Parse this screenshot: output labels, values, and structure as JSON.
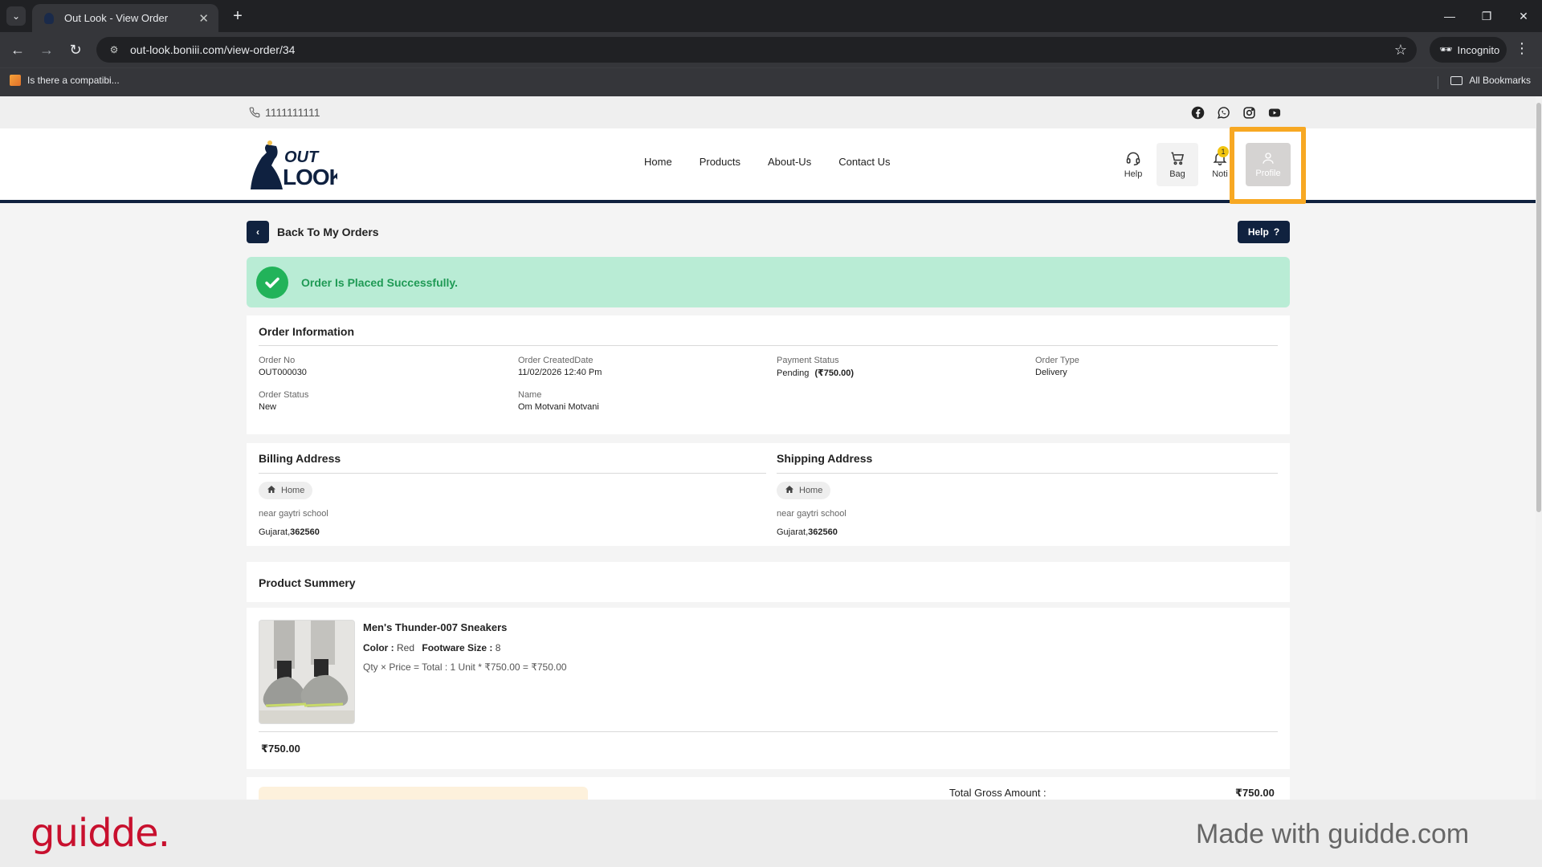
{
  "browser": {
    "tab_title": "Out Look - View Order",
    "url": "out-look.boniii.com/view-order/34",
    "profile_label": "Incognito",
    "bookmark_item": "Is there a compatibi...",
    "all_bookmarks": "All Bookmarks"
  },
  "site": {
    "phone": "1111111111",
    "socials": [
      "facebook-icon",
      "whatsapp-icon",
      "instagram-icon",
      "youtube-icon"
    ],
    "logo_text_top": "OUT",
    "logo_text_bottom": "LOOK",
    "nav": [
      "Home",
      "Products",
      "About-Us",
      "Contact Us"
    ],
    "header_actions": {
      "help": "Help",
      "bag": "Bag",
      "notifications": "Noti",
      "notification_count": "1",
      "profile": "Profile"
    }
  },
  "page": {
    "back_label": "Back To My Orders",
    "help_label": "Help",
    "success_message": "Order Is Placed Successfully.",
    "order_info": {
      "title": "Order Information",
      "fields": [
        {
          "label": "Order No",
          "value": "OUT000030"
        },
        {
          "label": "Order CreatedDate",
          "value": "11/02/2026 12:40 Pm"
        },
        {
          "label": "Payment Status",
          "value": "Pending",
          "extra": "(₹750.00)"
        },
        {
          "label": "Order Type",
          "value": "Delivery"
        },
        {
          "label": "Order Status",
          "value": "New"
        },
        {
          "label": "Name",
          "value": "Om Motvani Motvani"
        }
      ]
    },
    "billing": {
      "title": "Billing Address",
      "tag": "Home",
      "line1": "near gaytri school",
      "state": "Gujarat,",
      "pin": "362560"
    },
    "shipping": {
      "title": "Shipping Address",
      "tag": "Home",
      "line1": "near gaytri school",
      "state": "Gujarat,",
      "pin": "362560"
    },
    "product_summary": {
      "title": "Product Summery",
      "product": {
        "name": "Men's Thunder-007 Sneakers",
        "color_label": "Color :",
        "color": "Red",
        "size_label": "Footware Size :",
        "size": "8",
        "calc_label": "Qty × Price = Total :",
        "calc": "1 Unit * ₹750.00 = ₹750.00",
        "total": "₹750.00"
      }
    },
    "totals": {
      "gross_label": "Total Gross Amount :",
      "gross_value": "₹750.00"
    }
  },
  "watermark": {
    "brand": "guidde.",
    "made_with": "Made with guidde.com"
  },
  "colors": {
    "navy": "#10223f",
    "success_bg": "#b9ecd5",
    "success_text": "#1f9a55",
    "highlight": "#f7a823",
    "guidde_red": "#c8102e"
  }
}
